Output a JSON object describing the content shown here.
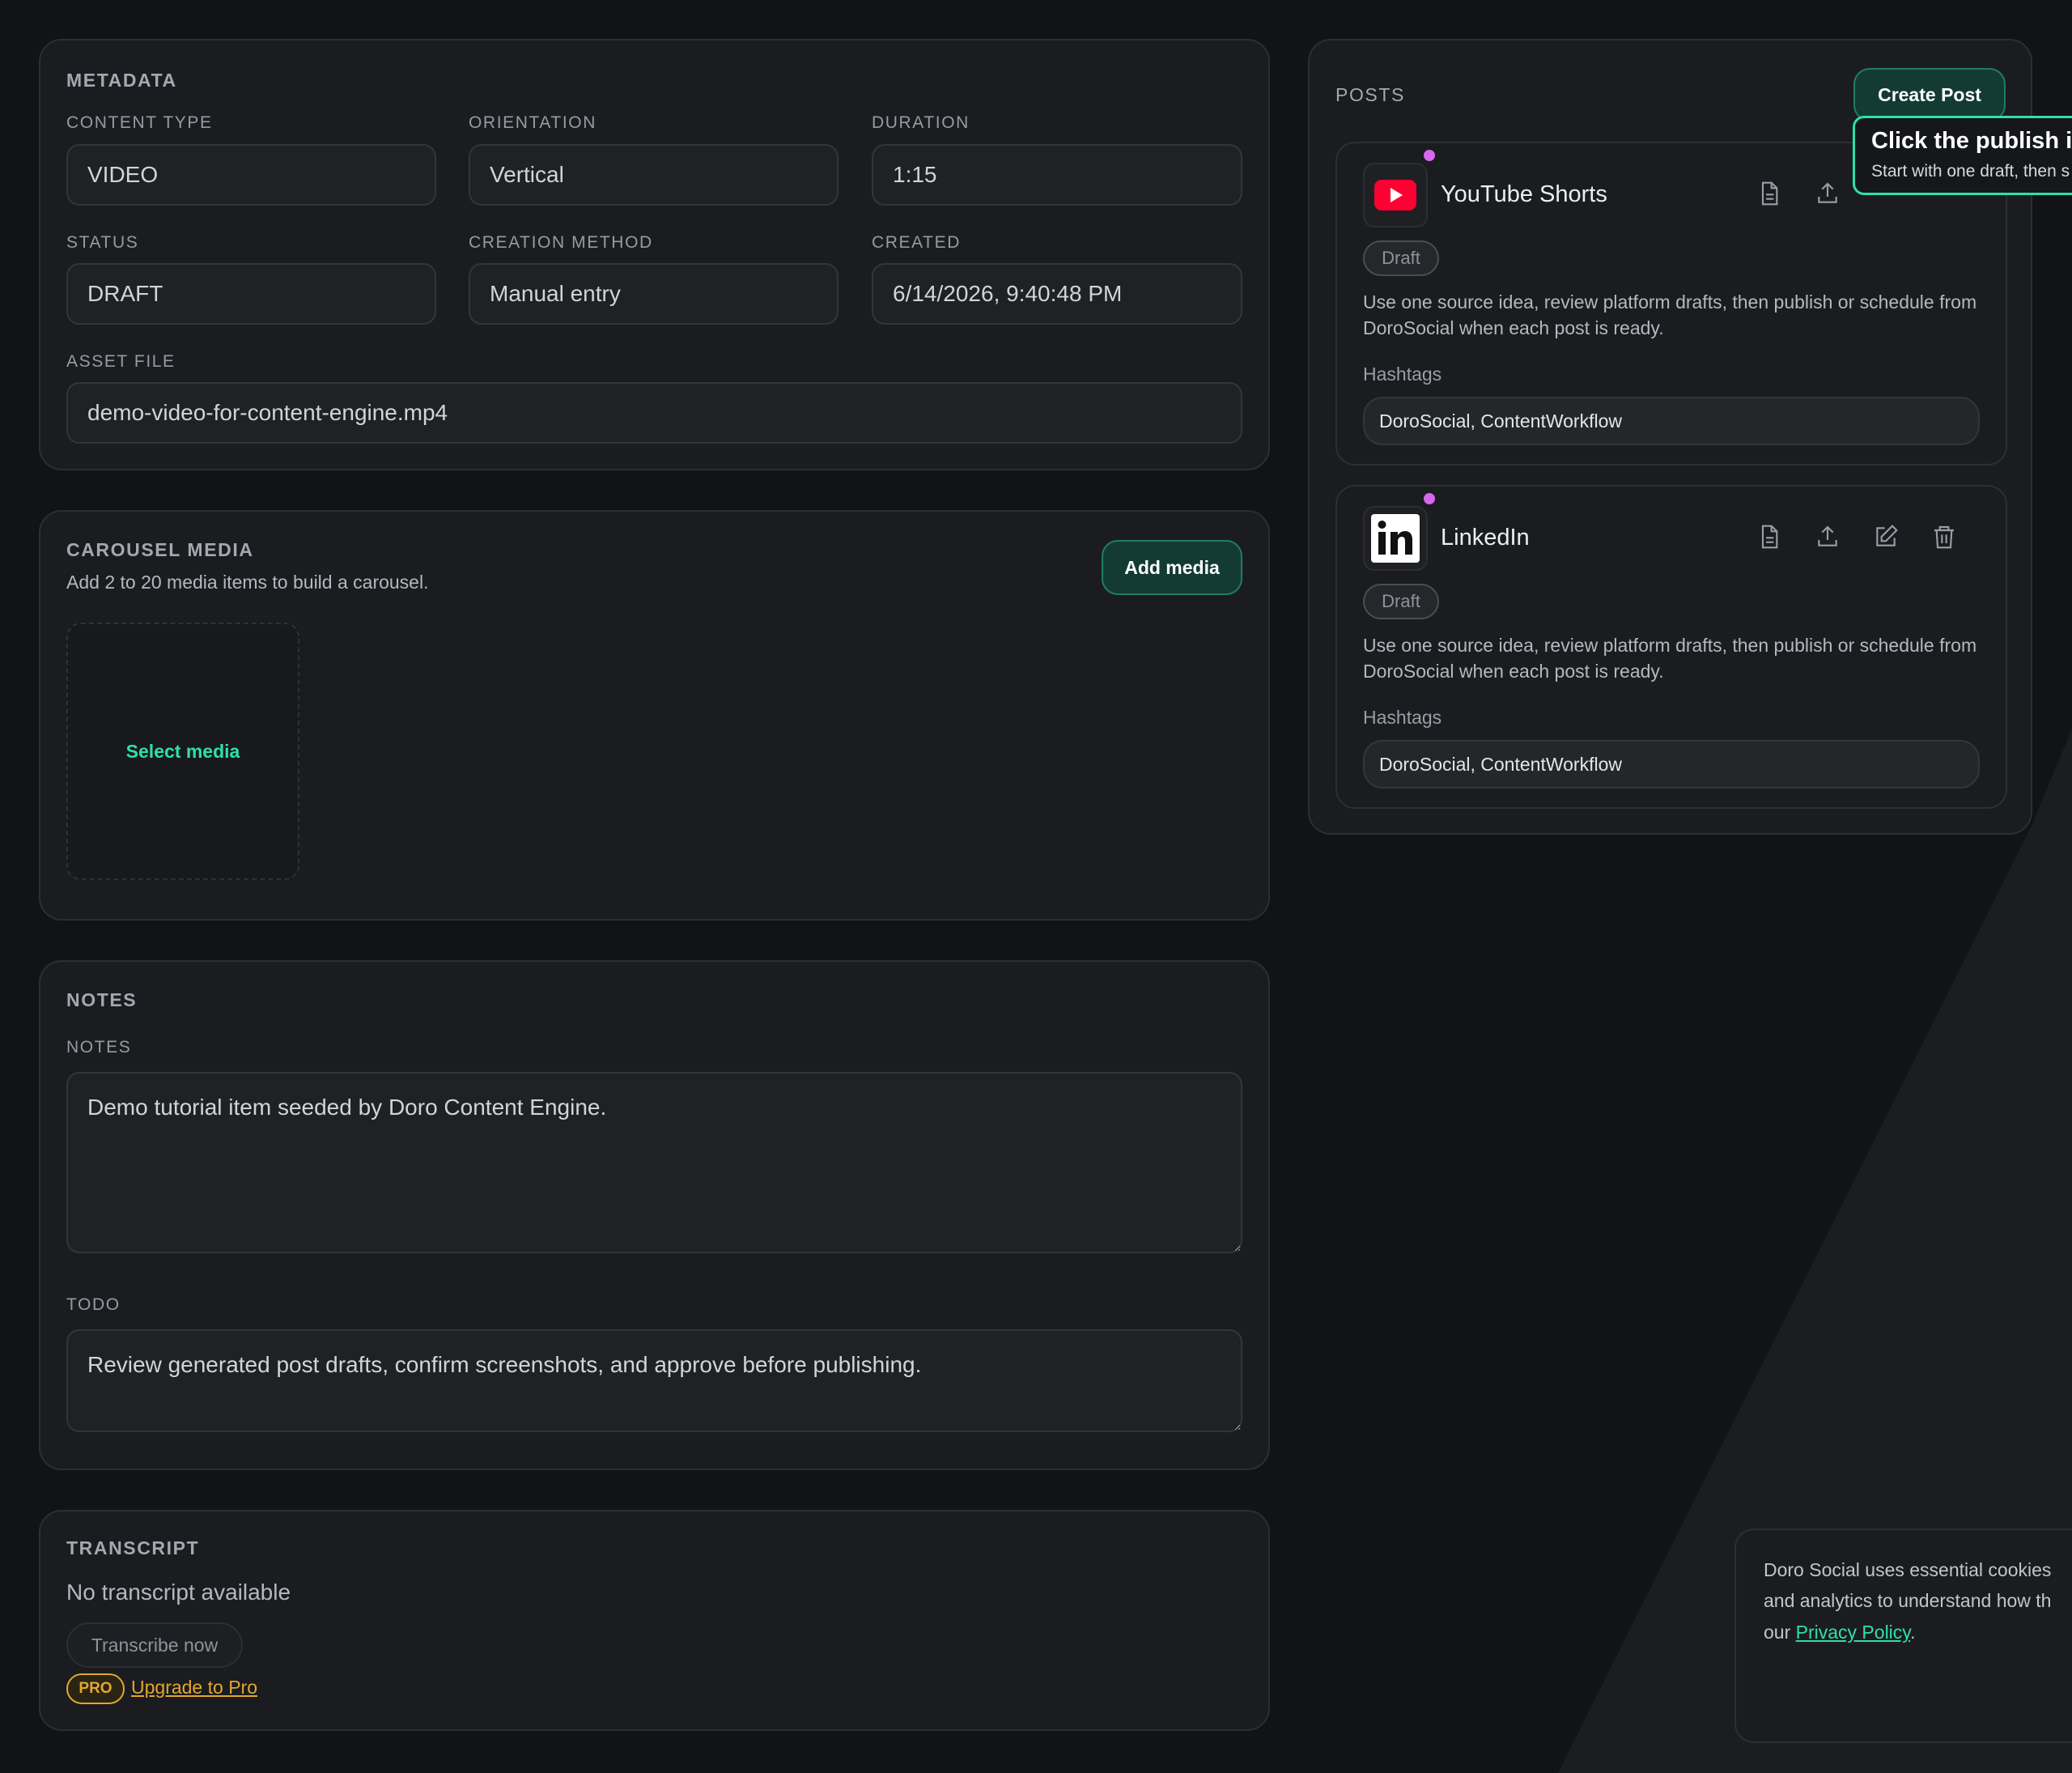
{
  "metadata": {
    "title": "METADATA",
    "content_type_label": "CONTENT TYPE",
    "content_type_value": "VIDEO",
    "orientation_label": "ORIENTATION",
    "orientation_value": "Vertical",
    "duration_label": "DURATION",
    "duration_value": "1:15",
    "status_label": "STATUS",
    "status_value": "DRAFT",
    "creation_method_label": "CREATION METHOD",
    "creation_method_value": "Manual entry",
    "created_label": "CREATED",
    "created_value": "6/14/2026, 9:40:48 PM",
    "asset_file_label": "ASSET FILE",
    "asset_file_value": "demo-video-for-content-engine.mp4"
  },
  "carousel": {
    "title": "CAROUSEL MEDIA",
    "subtitle": "Add 2 to 20 media items to build a carousel.",
    "add_button": "Add media",
    "select_media": "Select media"
  },
  "notes": {
    "title": "NOTES",
    "notes_label": "NOTES",
    "notes_value": "Demo tutorial item seeded by Doro Content Engine.",
    "todo_label": "TODO",
    "todo_value": "Review generated post drafts, confirm screenshots, and approve before publishing."
  },
  "transcript": {
    "title": "TRANSCRIPT",
    "empty_text": "No transcript available",
    "transcribe_button": "Transcribe now",
    "pro_badge": "PRO",
    "upgrade_link": "Upgrade to Pro"
  },
  "posts": {
    "title": "POSTS",
    "create_button": "Create Post",
    "tooltip_title": "Click the publish ic",
    "tooltip_body": "Start with one draft, then s",
    "items": [
      {
        "platform": "YouTube Shorts",
        "icon": "youtube-icon",
        "status": "Draft",
        "text": "Use one source idea, review platform drafts, then publish or schedule from DoroSocial when each post is ready.",
        "hashtags_label": "Hashtags",
        "hashtags": "DoroSocial, ContentWorkflow"
      },
      {
        "platform": "LinkedIn",
        "icon": "linkedin-icon",
        "status": "Draft",
        "text": "Use one source idea, review platform drafts, then publish or schedule from DoroSocial when each post is ready.",
        "hashtags_label": "Hashtags",
        "hashtags": "DoroSocial, ContentWorkflow"
      }
    ]
  },
  "cookie": {
    "line1": "Doro Social uses essential cookies",
    "line2": "and analytics to understand how th",
    "line3_prefix": "our ",
    "privacy_link": "Privacy Policy",
    "line3_suffix": "."
  },
  "colors": {
    "accent": "#2ee0a8",
    "button_bg": "#133b33",
    "draft_dot": "#d867f0",
    "pro": "#e3a72f",
    "youtube": "#ff0033"
  }
}
